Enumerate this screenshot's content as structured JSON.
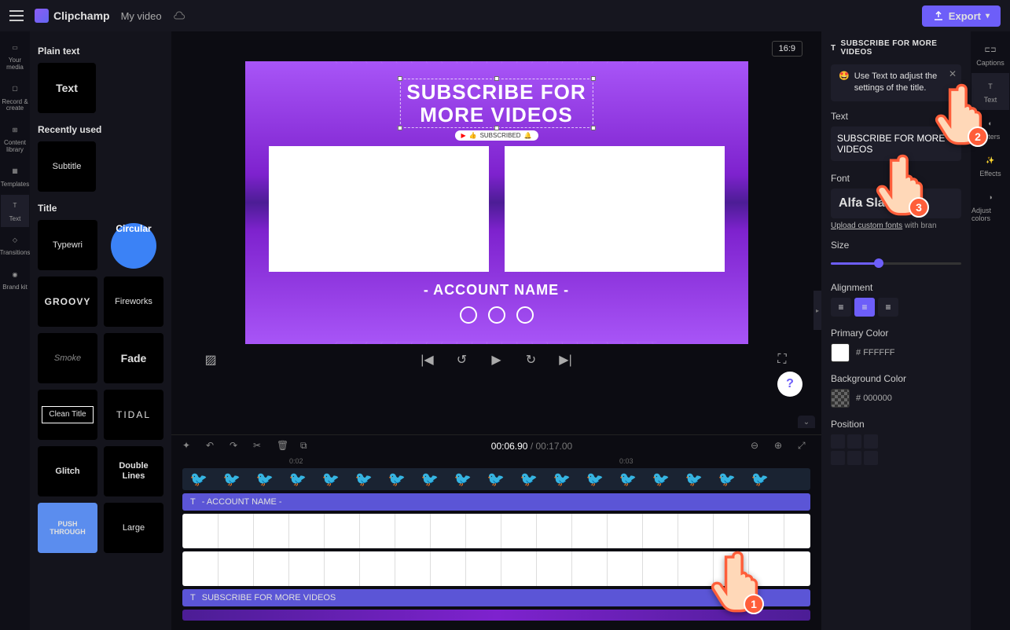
{
  "app": {
    "name": "Clipchamp",
    "project": "My video"
  },
  "export_label": "Export",
  "aspect": "16:9",
  "rail": [
    {
      "label": "Your media"
    },
    {
      "label": "Record & create"
    },
    {
      "label": "Content library"
    },
    {
      "label": "Templates"
    },
    {
      "label": "Text"
    },
    {
      "label": "Transitions"
    },
    {
      "label": "Brand kit"
    }
  ],
  "assets": {
    "plain_header": "Plain text",
    "plain": {
      "text": "Text"
    },
    "recent_header": "Recently used",
    "recent": {
      "subtitle": "Subtitle"
    },
    "title_header": "Title",
    "titles": [
      {
        "label": "Typewri"
      },
      {
        "label": "Circular"
      },
      {
        "label": "GROOVY"
      },
      {
        "label": "Fireworks"
      },
      {
        "label": "Smoke"
      },
      {
        "label": "Fade"
      },
      {
        "label": "Clean Title"
      },
      {
        "label": "TIDAL"
      },
      {
        "label": "Glitch"
      },
      {
        "label": "Double Lines"
      },
      {
        "label": "PUSH THROUGH"
      },
      {
        "label": "Large"
      }
    ]
  },
  "canvas": {
    "title": "SUBSCRIBE FOR\nMORE VIDEOS",
    "subscribe_pill": "SUBSCRIBED",
    "account": "- ACCOUNT NAME -"
  },
  "timeline": {
    "current": "00:06.90",
    "total": "00:17.00",
    "marks": [
      "0:02",
      "0:03"
    ],
    "track_account": "- ACCOUNT NAME -",
    "track_subscribe": "SUBSCRIBE FOR MORE VIDEOS"
  },
  "props": {
    "header": "SUBSCRIBE FOR MORE VIDEOS",
    "hint_emoji": "🤩",
    "hint": "Use Text to adjust the settings of the title.",
    "text_label": "Text",
    "text_value": "SUBSCRIBE FOR MORE VIDEOS",
    "font_label": "Font",
    "font_value": "Alfa Sla",
    "upload_prefix": "Upload custom fonts",
    "upload_suffix": " with bran",
    "size_label": "Size",
    "align_label": "Alignment",
    "primary_label": "Primary Color",
    "primary_hex": "FFFFFF",
    "bg_label": "Background Color",
    "bg_hex": "000000",
    "pos_label": "Position"
  },
  "right_rail": [
    {
      "label": "Captions"
    },
    {
      "label": "Text"
    },
    {
      "label": "Filters"
    },
    {
      "label": "Effects"
    },
    {
      "label": "Adjust colors"
    }
  ],
  "annotations": {
    "n1": "1",
    "n2": "2",
    "n3": "3"
  }
}
